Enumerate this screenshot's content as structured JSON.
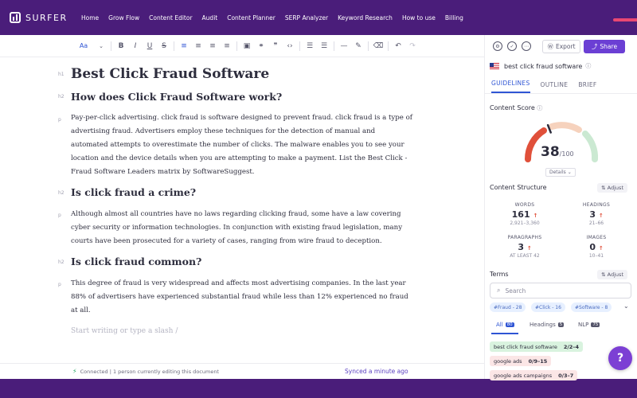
{
  "nav": {
    "logo": "SURFER",
    "items": [
      "Home",
      "Grow Flow",
      "Content Editor",
      "Audit",
      "Content Planner",
      "SERP Analyzer",
      "Keyword Research",
      "How to use",
      "Billing"
    ]
  },
  "toolbar": {
    "font_label": "Aa",
    "bold": "B",
    "italic": "I",
    "underline": "U",
    "strike": "S",
    "align_left": "≡",
    "align_center": "≡",
    "align_right": "≡",
    "align_justify": "≡",
    "image": "▣",
    "link": "⚭",
    "quote": "❞",
    "code": "‹›",
    "ordered_list": "☰",
    "bullet_list": "☰",
    "hr": "—",
    "highlight": "✎",
    "clear": "⌫",
    "undo": "↶",
    "redo": "↷"
  },
  "document": {
    "h1_tag": "h1",
    "h2_tag": "h2",
    "p_tag": "p",
    "title": "Best Click Fraud Software",
    "section1_heading": "How does Click Fraud Software work?",
    "section1_para": "Pay-per-click advertising. click fraud is software designed to prevent fraud. click fraud is a type of advertising fraud. Advertisers employ these techniques for the detection of manual and automated attempts to overestimate the number of clicks. The malware enables you to see your location and the device details when you are attempting to make a payment. List the Best Click - Fraud Software Leaders matrix by SoftwareSuggest.",
    "section2_heading": "Is click fraud a crime?",
    "section2_para": "Although almost all countries have no laws regarding clicking fraud, some have a law covering cyber security or information technologies. In conjunction with existing fraud legislation, many courts have been prosecuted for a variety of cases, ranging from wire fraud to deception.",
    "section3_heading": "Is click fraud common?",
    "section3_para": "This degree of fraud is very widespread and affects most advertising companies. In the last year 88% of advertisers have experienced substantial fraud while less than 12% experienced no fraud at all.",
    "placeholder": "Start writing or type a slash /"
  },
  "status": {
    "connection": "Connected | 1 person currently editing this document",
    "synced": "Synced a minute ago"
  },
  "panel": {
    "export_label": "Export",
    "share_label": "Share",
    "keyword": "best click fraud software",
    "tabs": [
      "GUIDELINES",
      "OUTLINE",
      "BRIEF"
    ],
    "content_score_label": "Content Score",
    "score": "38",
    "score_max": "/100",
    "score_value": 38,
    "details_label": "Details",
    "structure_label": "Content Structure",
    "adjust_label": "Adjust",
    "stats": [
      {
        "label": "WORDS",
        "value": "161",
        "range": "2,921–3,360"
      },
      {
        "label": "HEADINGS",
        "value": "3",
        "range": "21–66"
      },
      {
        "label": "PARAGRAPHS",
        "value": "3",
        "range": "AT LEAST 42"
      },
      {
        "label": "IMAGES",
        "value": "0",
        "range": "10–41"
      }
    ],
    "terms_label": "Terms",
    "search_placeholder": "Search",
    "chips": [
      "#Fraud - 28",
      "#Click - 16",
      "#Software - 8"
    ],
    "filters": [
      {
        "label": "All",
        "count": "80"
      },
      {
        "label": "Headings",
        "count": "5"
      },
      {
        "label": "NLP",
        "count": "75"
      }
    ],
    "terms": [
      {
        "text": "best click fraud software",
        "count": "2/2–4"
      },
      {
        "text": "google ads",
        "count": "0/9–15"
      },
      {
        "text": "google ads campaigns",
        "count": "0/3–7"
      }
    ]
  },
  "colors": {
    "nav_bg": "#4a1d7a",
    "accent_blue": "#2f55d4",
    "share_purple": "#6b3fd4",
    "gauge_red": "#e0503a",
    "gauge_green": "#cbe9d2"
  }
}
